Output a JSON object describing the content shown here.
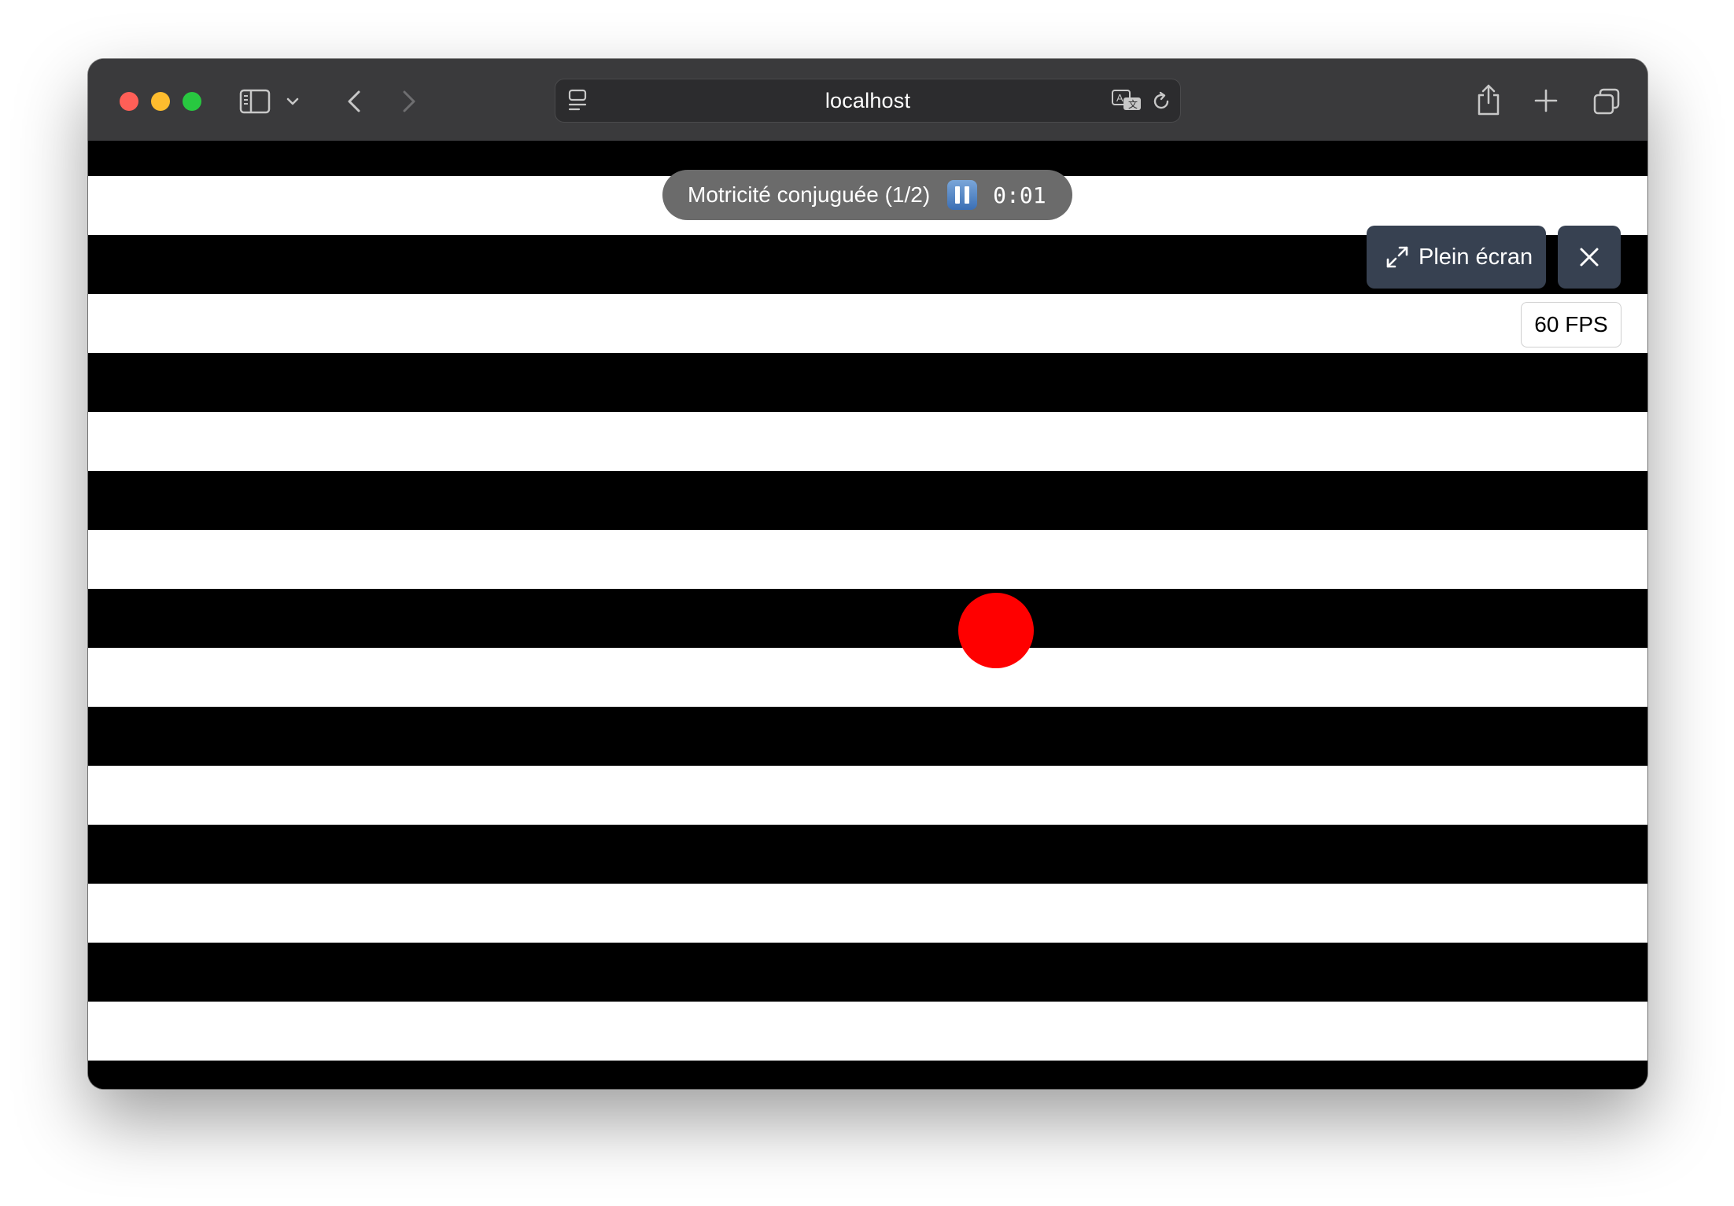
{
  "browser": {
    "url": "localhost",
    "icons": {
      "sidebar": "sidebar-icon",
      "sidebar_menu": "chevron-down-icon",
      "back": "chevron-left-icon",
      "forward": "chevron-right-icon",
      "site_settings": "page-menu-icon",
      "translate": "translate-icon",
      "reload": "reload-icon",
      "share": "share-icon",
      "new_tab": "plus-icon",
      "tab_overview": "tabs-icon"
    }
  },
  "exercise": {
    "title": "Motricité conjuguée (1/2)",
    "timer": "0:01",
    "pause_icon": "pause-icon",
    "fullscreen_label": "Plein écran",
    "fullscreen_icon": "expand-icon",
    "close_icon": "close-icon",
    "fps_label": "60 FPS",
    "stimulus": {
      "pattern": "horizontal black and white stripes",
      "stripe_colors": [
        "#000000",
        "#ffffff"
      ],
      "target_color": "#ff0000"
    }
  }
}
